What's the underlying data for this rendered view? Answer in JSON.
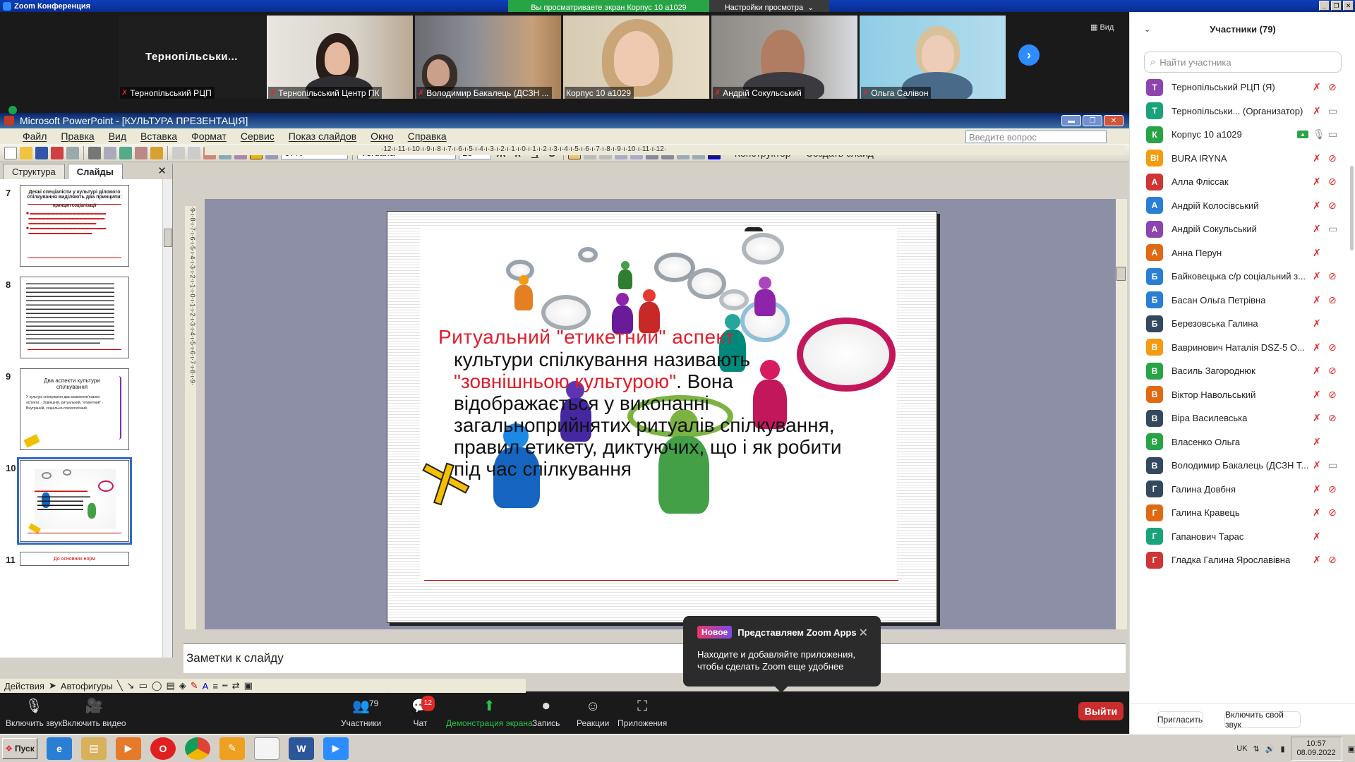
{
  "zoom": {
    "window_title": "Zoom Конференция",
    "share_banner": "Вы просматриваете экран Корпус 10 а1029",
    "view_settings": "Настройки просмотра",
    "view_button": "Вид",
    "tiles": [
      {
        "name": "Тернопільський РЦП",
        "label": "Тернопільськи..."
      },
      {
        "name": "Тернопільський Центр ПК"
      },
      {
        "name": "Володимир Бакалець (ДСЗН ..."
      },
      {
        "name": "Корпус 10 а1029"
      },
      {
        "name": "Андрій Сокульський"
      },
      {
        "name": "Ольга Салівон"
      }
    ],
    "controls": {
      "mute": "Включить звук",
      "video": "Включить видео",
      "participants": "Участники",
      "participants_count": "79",
      "chat": "Чат",
      "chat_badge": "12",
      "share": "Демонстрация экрана",
      "record": "Запись",
      "reactions": "Реакции",
      "apps": "Приложения",
      "leave": "Выйти"
    },
    "tooltip": {
      "badge": "Новое",
      "title": "Представляем Zoom Apps",
      "message": "Находите и добавляйте приложения, чтобы сделать Zoom еще удобнее"
    }
  },
  "ppt": {
    "title": "Microsoft PowerPoint - [КУЛЬТУРА ПРЕЗЕНТАЦІЯ]",
    "menu": [
      "Файл",
      "Правка",
      "Вид",
      "Вставка",
      "Формат",
      "Сервис",
      "Показ слайдов",
      "Окно",
      "Справка"
    ],
    "ask_placeholder": "Введите вопрос",
    "zoom_level": "67%",
    "font": "Verdana",
    "font_size": "18",
    "format_buttons": [
      "Ж",
      "К",
      "Ч",
      "S"
    ],
    "designer": "Конструктор",
    "new_slide": "Создать слайд",
    "pane_tabs": [
      "Структура",
      "Слайды"
    ],
    "ruler_top": "·12·ı·11·ı·10·ı·9·ı·8·ı·7·ı·6·ı·5·ı·4·ı·3·ı·2·ı·1·ı·0·ı·1·ı·2·ı·3·ı·4·ı·5·ı·6·ı·7·ı·8·ı·9·ı·10·ı·11·ı·12·",
    "ruler_left": "·9·ı·8·ı·7·ı·6·ı·5·ı·4·ı·3·ı·2·ı·1·ı·0·ı·1·ı·2·ı·3·ı·4·ı·5·ı·6·ı·7·ı·8·ı·9·",
    "thumbnails": [
      {
        "num": "7",
        "title": "Деякі спеціалісти у культурі ділового спілкування виділяють два принципи:",
        "sub": "принцип соціалізації"
      },
      {
        "num": "8",
        "title": ""
      },
      {
        "num": "9",
        "title": "Два аспекти культури спілкування",
        "sub": "У культурі спілкування два взаємопов'язаних аспекти: · Зовнішній, ритуальний, \"етикетний\" · Внутрішній, соціально-психологічний"
      },
      {
        "num": "10",
        "title": ""
      },
      {
        "num": "11",
        "title": "До основних норм"
      }
    ],
    "slide": {
      "title": "Ритуальний \"етикетний\" аспект",
      "body_pre": "культури спілкування називають ",
      "body_red": "\"зовнішньою культурою\"",
      "body_post": ". Вона відображається у виконанні загальноприйнятих ритуалів спілкування, правил етикету, диктуючих, що і як робити під час спілкування"
    },
    "notes_placeholder": "Заметки к слайду",
    "draw_actions": "Действия",
    "autoshapes": "Автофигуры"
  },
  "participants": {
    "header": "Участники (79)",
    "search_placeholder": "Найти участника",
    "list": [
      {
        "initial": "Т",
        "name": "Тернопільський РЦП (Я)",
        "color": "#8e44ad",
        "cam": false
      },
      {
        "initial": "Т",
        "name": "Тернопільськи... (Организатор)",
        "color": "#1aa37a",
        "cam": true
      },
      {
        "initial": "К",
        "name": "Корпус 10 а1029",
        "color": "#27a446",
        "cam": true,
        "share": true
      },
      {
        "initial": "BI",
        "name": "BURA IRYNA",
        "color": "#f39c12",
        "cam": false
      },
      {
        "initial": "А",
        "name": "Алла Фліссак",
        "color": "#d03434",
        "cam": false
      },
      {
        "initial": "А",
        "name": "Андрій Колосівський",
        "color": "#2a7fd4",
        "cam": false
      },
      {
        "initial": "А",
        "name": "Андрій Сокульський",
        "color": "#8e44ad",
        "cam": true
      },
      {
        "initial": "А",
        "name": "Анна Перун",
        "color": "#e06a14",
        "cam": null
      },
      {
        "initial": "Б",
        "name": "Байковецька с/р соціальний з...",
        "color": "#2a7fd4",
        "cam": false
      },
      {
        "initial": "Б",
        "name": "Басан Ольга Петрівна",
        "color": "#2a7fd4",
        "cam": false
      },
      {
        "initial": "Б",
        "name": "Березовська Галина",
        "color": "#34495e",
        "cam": null
      },
      {
        "initial": "В",
        "name": "Вавринович Наталія DSZ-5 О...",
        "color": "#f39c12",
        "cam": false
      },
      {
        "initial": "В",
        "name": "Василь Загороднюк",
        "color": "#27a446",
        "cam": false
      },
      {
        "initial": "В",
        "name": "Віктор Навольський",
        "color": "#e06a14",
        "cam": false
      },
      {
        "initial": "В",
        "name": "Віра Василевська",
        "color": "#34495e",
        "cam": false
      },
      {
        "initial": "В",
        "name": "Власенко Ольга",
        "color": "#27a446",
        "cam": null
      },
      {
        "initial": "В",
        "name": "Володимир Бакалець (ДСЗН Т...",
        "color": "#34495e",
        "cam": true
      },
      {
        "initial": "Г",
        "name": "Галина Довбня",
        "color": "#34495e",
        "cam": false
      },
      {
        "initial": "Г",
        "name": "Галина Кравець",
        "color": "#e06a14",
        "cam": false
      },
      {
        "initial": "Г",
        "name": "Гапанович Тарас",
        "color": "#1aa37a",
        "cam": null
      },
      {
        "initial": "Г",
        "name": "Гладка Галина Ярославівна",
        "color": "#d03434",
        "cam": false
      }
    ],
    "invite": "Пригласить",
    "unmute_me": "Включить свой звук"
  },
  "taskbar": {
    "start": "Пуск",
    "lang": "UK",
    "time": "10:57",
    "date": "08.09.2022"
  }
}
